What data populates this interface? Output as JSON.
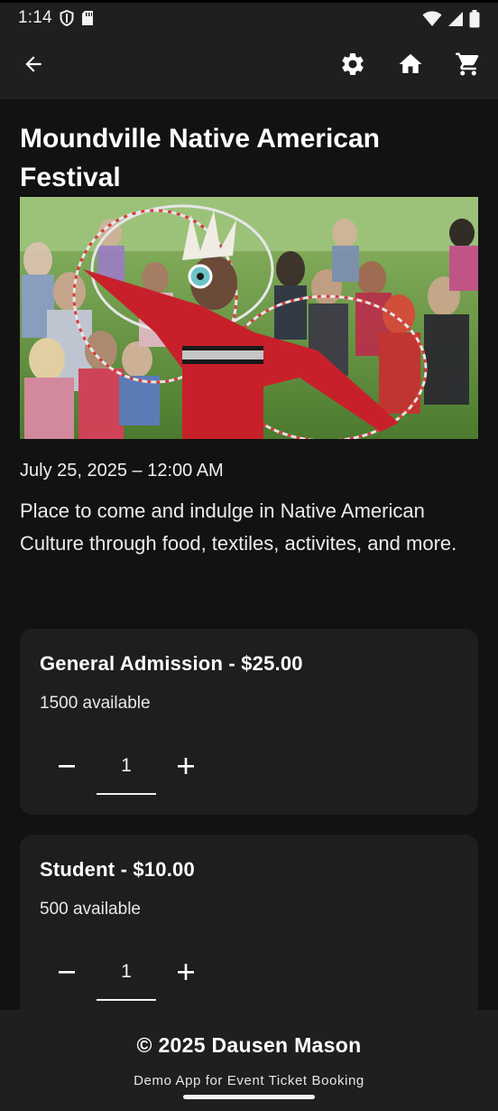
{
  "status_bar": {
    "time": "1:14",
    "left_icons": [
      "shield-icon",
      "sd-card-icon"
    ],
    "right_icons": [
      "wifi-icon",
      "signal-icon",
      "battery-icon"
    ]
  },
  "app_bar": {
    "back_icon": "arrow-back-icon",
    "actions": [
      "settings-icon",
      "home-icon",
      "cart-icon"
    ]
  },
  "event": {
    "title": "Moundville Native American Festival",
    "image_alt": "Native American dancer in red regalia with hoops performing before a crowd",
    "date": "July 25, 2025 – 12:00 AM",
    "description": "Place to come and indulge in Native American Culture through food, textiles, activites, and more."
  },
  "tickets": [
    {
      "name": "General Admission - $25.00",
      "available": "1500 available",
      "quantity": "1"
    },
    {
      "name": "Student - $10.00",
      "available": "500 available",
      "quantity": "1"
    }
  ],
  "footer": {
    "copyright": "© 2025 Dausen Mason",
    "subtitle": "Demo App for Event Ticket Booking"
  },
  "colors": {
    "background": "#121212",
    "app_bar": "#1f1f1f",
    "card": "#1e1e1e",
    "text": "#ffffff"
  }
}
